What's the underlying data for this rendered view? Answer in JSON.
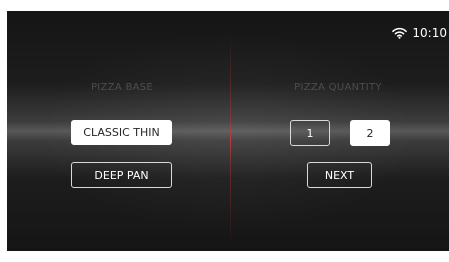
{
  "status_bar": {
    "wifi_icon": "wifi-icon",
    "time": "10:10"
  },
  "pizza_base": {
    "heading": "PIZZA BASE",
    "options": [
      {
        "label": "CLASSIC THIN",
        "selected": true
      },
      {
        "label": "DEEP PAN",
        "selected": false
      }
    ]
  },
  "pizza_quantity": {
    "heading": "PIZZA QUANTITY",
    "options": [
      {
        "label": "1",
        "selected": false
      },
      {
        "label": "2",
        "selected": true
      }
    ],
    "next_label": "NEXT"
  },
  "colors": {
    "accent_divider": "#c83232",
    "selected_bg": "#ffffff",
    "background": "#151515"
  }
}
